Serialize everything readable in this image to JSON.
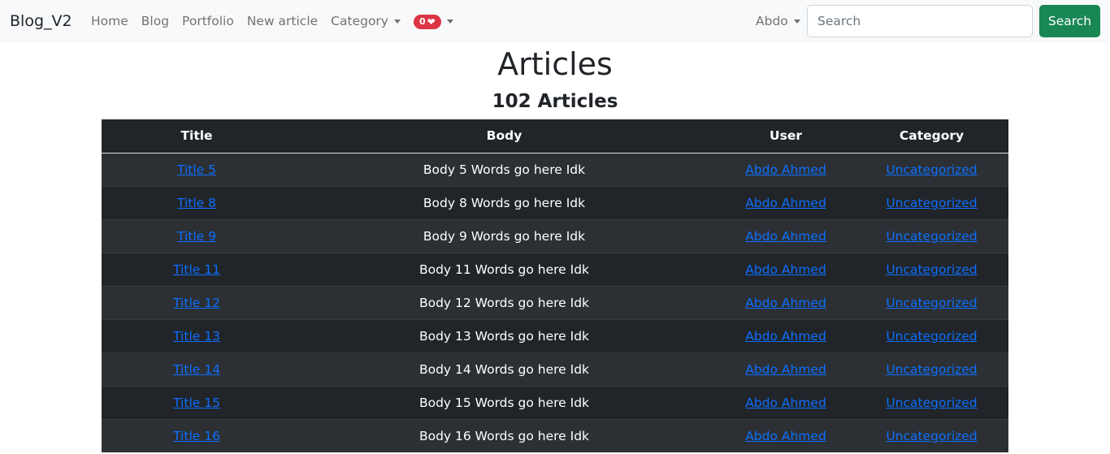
{
  "navbar": {
    "brand": "Blog_V2",
    "links": [
      "Home",
      "Blog",
      "Portfolio",
      "New article"
    ],
    "category_label": "Category",
    "badge_count": "0",
    "user_label": "Abdo",
    "search_placeholder": "Search",
    "search_button": "Search"
  },
  "page": {
    "title": "Articles",
    "subtitle": "102 Articles"
  },
  "table": {
    "headers": [
      "Title",
      "Body",
      "User",
      "Category"
    ],
    "rows": [
      {
        "title": "Title 5",
        "body": "Body 5 Words go here Idk",
        "user": "Abdo Ahmed",
        "category": "Uncategorized"
      },
      {
        "title": "Title 8",
        "body": "Body 8 Words go here Idk",
        "user": "Abdo Ahmed",
        "category": "Uncategorized"
      },
      {
        "title": "Title 9",
        "body": "Body 9 Words go here Idk",
        "user": "Abdo Ahmed",
        "category": "Uncategorized"
      },
      {
        "title": "Title 11",
        "body": "Body 11 Words go here Idk",
        "user": "Abdo Ahmed",
        "category": "Uncategorized"
      },
      {
        "title": "Title 12",
        "body": "Body 12 Words go here Idk",
        "user": "Abdo Ahmed",
        "category": "Uncategorized"
      },
      {
        "title": "Title 13",
        "body": "Body 13 Words go here Idk",
        "user": "Abdo Ahmed",
        "category": "Uncategorized"
      },
      {
        "title": "Title 14",
        "body": "Body 14 Words go here Idk",
        "user": "Abdo Ahmed",
        "category": "Uncategorized"
      },
      {
        "title": "Title 15",
        "body": "Body 15 Words go here Idk",
        "user": "Abdo Ahmed",
        "category": "Uncategorized"
      },
      {
        "title": "Title 16",
        "body": "Body 16 Words go here Idk",
        "user": "Abdo Ahmed",
        "category": "Uncategorized"
      }
    ]
  },
  "colors": {
    "navbar_bg": "#f8f9fa",
    "table_dark": "#212529",
    "table_stripe": "#2c3034",
    "link": "#0d6efd",
    "badge": "#dc3545",
    "search_button": "#198754"
  },
  "icons": {
    "badge_icon": "heart-icon",
    "dropdown_icon": "chevron-down-icon"
  }
}
